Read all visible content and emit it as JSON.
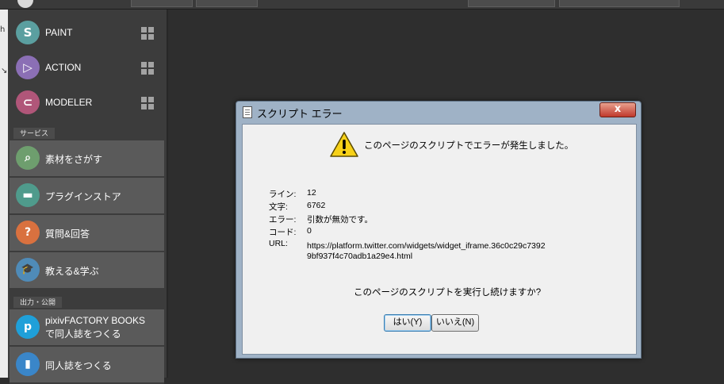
{
  "sidebar": {
    "edge_text": "h",
    "apps": [
      {
        "label": "PAINT",
        "color": "#5b9fa0",
        "glyph": "S"
      },
      {
        "label": "ACTION",
        "color": "#8b6fb5",
        "glyph": "▷"
      },
      {
        "label": "MODELER",
        "color": "#b05679",
        "glyph": "⊂"
      }
    ],
    "section_services": "サービス",
    "services": [
      {
        "label": "素材をさがす",
        "color": "#6e9e6e",
        "glyph": "⌕"
      },
      {
        "label": "プラグインストア",
        "color": "#4f9b8c",
        "glyph": "▬"
      },
      {
        "label": "質問&回答",
        "color": "#d9713f",
        "glyph": "?"
      },
      {
        "label": "教える&学ぶ",
        "color": "#4f8bb8",
        "glyph": "🎓"
      }
    ],
    "section_publish": "出力・公開",
    "publish": [
      {
        "label": "pixivFACTORY BOOKS\nで同人誌をつくる",
        "color": "#1fa0d9",
        "glyph": "p"
      },
      {
        "label": "同人誌をつくる",
        "color": "#3a86c9",
        "glyph": "▮"
      }
    ]
  },
  "dialog": {
    "title": "スクリプト エラー",
    "close_glyph": "x",
    "message": "このページのスクリプトでエラーが発生しました。",
    "fields": [
      {
        "label": "ライン:",
        "value": "12"
      },
      {
        "label": "文字:",
        "value": "6762"
      },
      {
        "label": "エラー:",
        "value": "引数が無効です。"
      },
      {
        "label": "コード:",
        "value": "0"
      },
      {
        "label": "URL:",
        "value": "https://platform.twitter.com/widgets/widget_iframe.36c0c29c7392"
      }
    ],
    "url_line2": "9bf937f4c70adb1a29e4.html",
    "question": "このページのスクリプトを実行し続けますか?",
    "yes_label": "はい(Y)",
    "no_label": "いいえ(N)"
  }
}
